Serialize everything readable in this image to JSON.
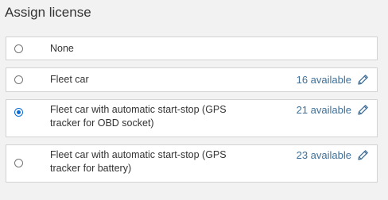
{
  "panel": {
    "title": "Assign license"
  },
  "options": [
    {
      "label": "None",
      "selected": false,
      "available": "",
      "editable": false
    },
    {
      "label": "Fleet car",
      "selected": false,
      "available": "16 available",
      "editable": true
    },
    {
      "label": "Fleet car with automatic start-stop (GPS tracker for OBD socket)",
      "selected": true,
      "available": "21 available",
      "editable": true
    },
    {
      "label": "Fleet car with automatic start-stop (GPS tracker for battery)",
      "selected": false,
      "available": "23 available",
      "editable": true
    }
  ],
  "colors": {
    "background": "#f2f2f2",
    "accent": "#0a6cd7",
    "link": "#3f6f98",
    "border": "#d3d3d3"
  },
  "icons": {
    "radio": "radio-button",
    "edit": "pencil-icon"
  }
}
